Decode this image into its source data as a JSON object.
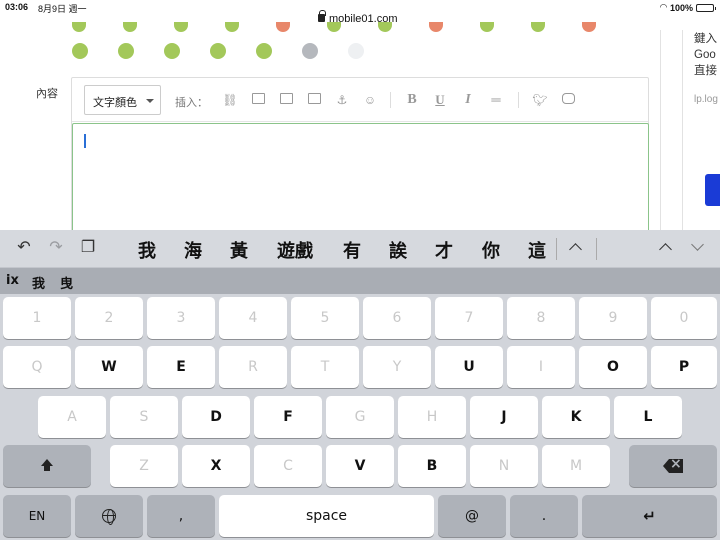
{
  "status": {
    "time": "03:06",
    "date": "8月9日 週一",
    "url": "mobile01.com",
    "battery": "100%",
    "battery_level": 1.0
  },
  "editor": {
    "label": "內容",
    "color_select": "文字顏色",
    "insert_label": "插入：",
    "toolbar_icons": [
      "link-icon",
      "image-icon",
      "gallery-icon",
      "video-icon",
      "anchor-icon",
      "emoticon-icon"
    ],
    "format_icons": [
      "bold-icon",
      "underline-icon",
      "italic-icon",
      "strikethrough-icon"
    ],
    "social_icons": [
      "twitter-icon",
      "instagram-icon"
    ],
    "bold": "B",
    "underline": "U",
    "italic": "I",
    "strike": "═"
  },
  "sidebar": {
    "text_lines": [
      "鍵入",
      "Goo",
      "直接"
    ],
    "link": "lp.log"
  },
  "keyboard": {
    "candidates": [
      "我",
      "海",
      "黃",
      "遊戲",
      "有",
      "誒",
      "才",
      "你",
      "這"
    ],
    "pinyin": [
      "ix",
      "我",
      "曳"
    ],
    "row_numbers": [
      "1",
      "2",
      "3",
      "4",
      "5",
      "6",
      "7",
      "8",
      "9",
      "0"
    ],
    "row1": [
      "Q",
      "W",
      "E",
      "R",
      "T",
      "Y",
      "U",
      "I",
      "O",
      "P"
    ],
    "row2": [
      "A",
      "S",
      "D",
      "F",
      "G",
      "H",
      "J",
      "K",
      "L"
    ],
    "row3": [
      "Z",
      "X",
      "C",
      "V",
      "B",
      "N",
      "M"
    ],
    "bottom": {
      "en": "EN",
      "comma": ",",
      "space": "space",
      "at": "@",
      "dot": ".",
      "enter": "↵"
    }
  }
}
